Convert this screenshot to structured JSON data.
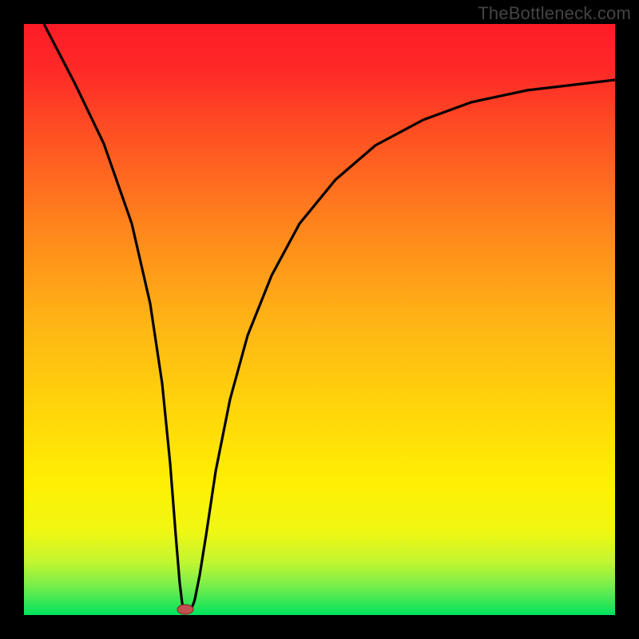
{
  "watermark": "TheBottleneck.com",
  "chart_data": {
    "type": "line",
    "title": "",
    "xlabel": "",
    "ylabel": "",
    "xlim": [
      0,
      1
    ],
    "ylim": [
      0,
      1
    ],
    "x": [
      0.0,
      0.03,
      0.05,
      0.08,
      0.1,
      0.12,
      0.15,
      0.17,
      0.2,
      0.22,
      0.24,
      0.26,
      0.28,
      0.29,
      0.3,
      0.32,
      0.34,
      0.37,
      0.4,
      0.44,
      0.48,
      0.53,
      0.58,
      0.64,
      0.7,
      0.77,
      0.84,
      0.92,
      1.0
    ],
    "y": [
      1.0,
      0.88,
      0.77,
      0.66,
      0.56,
      0.45,
      0.35,
      0.25,
      0.15,
      0.07,
      0.02,
      0.0,
      0.02,
      0.08,
      0.15,
      0.24,
      0.33,
      0.42,
      0.51,
      0.59,
      0.66,
      0.72,
      0.77,
      0.8,
      0.83,
      0.85,
      0.87,
      0.88,
      0.88
    ],
    "marker": {
      "x": 0.26,
      "y": 0.0
    },
    "background_gradient": {
      "top": "#fe1b27",
      "mid": "#fece00",
      "bottom": "#00e35f"
    }
  }
}
